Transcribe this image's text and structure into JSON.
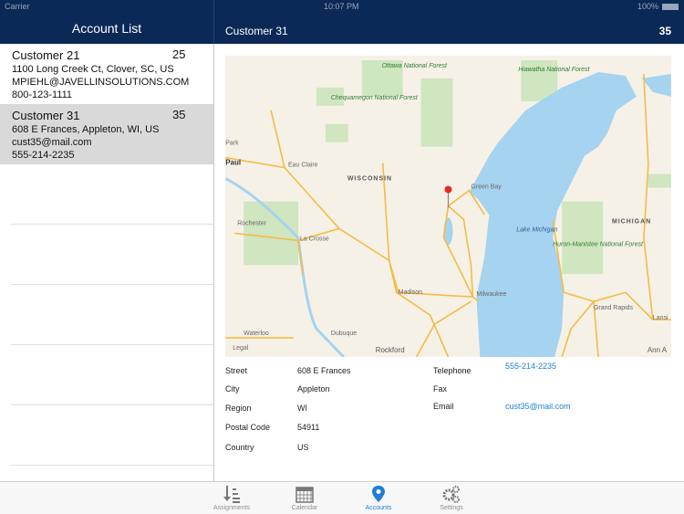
{
  "status": {
    "carrier": "Carrier",
    "time": "10:07 PM",
    "battery": "100%"
  },
  "nav": {
    "left_title": "Account List",
    "right_title": "Customer 31",
    "right_number": "35"
  },
  "accounts": [
    {
      "name": "Customer 21",
      "number": "25",
      "address": "1100 Long Creek Ct, Clover, SC, US",
      "email": "MPIEHL@JAVELLINSOLUTIONS.COM",
      "phone": "800-123-1111",
      "selected": false
    },
    {
      "name": "Customer 31",
      "number": "35",
      "address": "608 E Frances, Appleton, WI, US",
      "email": "cust35@mail.com",
      "phone": "555-214-2235",
      "selected": true
    }
  ],
  "map": {
    "labels": {
      "ottawa": "Ottawa National Forest",
      "hiawatha": "Hiawatha National Forest",
      "chequamegon": "Chequamegon National Forest",
      "park": "Park",
      "paul": "Paul",
      "eau_claire": "Eau Claire",
      "wisconsin": "WISCONSIN",
      "green_bay": "Green Bay",
      "rochester": "Rochester",
      "la_crosse": "La Crosse",
      "lake_michigan": "Lake Michigan",
      "michigan": "MICHIGAN",
      "huron": "Huron-Manistee National Forest",
      "madison": "Madison",
      "milwaukee": "Milwaukee",
      "grand_rapids": "Grand Rapids",
      "lansing": "Lansi",
      "waterloo": "Waterloo",
      "dubuque": "Dubuque",
      "rockford": "Rockford",
      "ann_arbor": "Ann A",
      "legal": "Legal"
    },
    "pin_color": "#e8262a",
    "water_color": "#a6d3f0"
  },
  "details": {
    "street_label": "Street",
    "street": "608 E Frances",
    "city_label": "City",
    "city": "Appleton",
    "region_label": "Region",
    "region": "WI",
    "postal_label": "Postal Code",
    "postal": "54911",
    "country_label": "Country",
    "country": "US",
    "telephone_label": "Telephone",
    "telephone": "555-214-2235",
    "fax_label": "Fax",
    "email_label": "Email",
    "email": "cust35@mail.com"
  },
  "tabs": [
    {
      "label": "Assignments",
      "icon": "sort-list-icon"
    },
    {
      "label": "Calendar",
      "icon": "calendar-icon"
    },
    {
      "label": "Accounts",
      "icon": "map-pin-icon",
      "active": true
    },
    {
      "label": "Settings",
      "icon": "gears-icon"
    }
  ],
  "colors": {
    "navbar": "#0b2957",
    "accent": "#1f7ed6",
    "selected_row": "#d9d9d9"
  }
}
